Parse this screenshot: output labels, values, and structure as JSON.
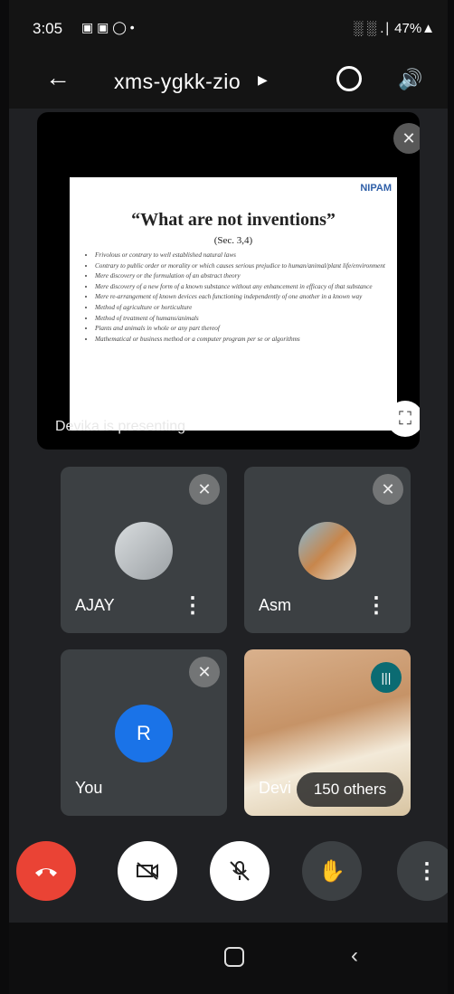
{
  "status": {
    "time": "3:05",
    "icons": "▣ ▣ ◯ •",
    "right": "░ ░ .∣ 47%▲"
  },
  "header": {
    "back": "←",
    "title": "xms-ygkk-zio",
    "title_arrow": "▶",
    "speaker": "🔊"
  },
  "slide": {
    "logo": "NIPAM",
    "title": "“What are not inventions”",
    "subtitle": "(Sec. 3,4)",
    "bullets": [
      "Frivolous or contrary to well established natural laws",
      "Contrary to public order or morality or which causes serious prejudice to human/animal/plant life/environment",
      "Mere discovery or the formulation of an abstract theory",
      "Mere discovery of a new form of a known substance without any enhancement in efficacy of that substance",
      "Mere re-arrangement of known devices each functioning independently of one another in a known way",
      "Method of agriculture or horticulture",
      "Method of treatment of humans/animals",
      "Plants and animals in whole or any part thereof",
      "Mathematical or business method or a computer program per se or algorithms"
    ]
  },
  "presenting_label": "Devika is presenting",
  "participants": {
    "ajay": {
      "name": "AJAY"
    },
    "asm": {
      "name": "Asm"
    },
    "you": {
      "name": "You",
      "initial": "R"
    },
    "devika": {
      "name": "Devi",
      "others": "150 others"
    }
  },
  "icons": {
    "mic_off": "mic-off-icon",
    "fullscreen": "fullscreen-icon",
    "more": "more-vert-icon"
  }
}
